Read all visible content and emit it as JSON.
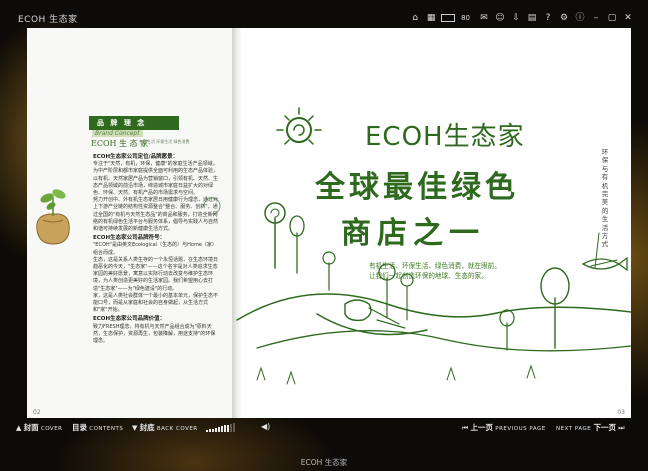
{
  "app": {
    "title": "ECOH 生态家",
    "bottom_title": "ECOH 生态家",
    "zoom_value": "80"
  },
  "toolbar_icons": [
    "home-icon",
    "thumbnails-icon",
    "zoom-out-icon",
    "zoom-in-icon",
    "comment-icon",
    "user-icon",
    "download-icon",
    "print-icon",
    "help-icon",
    "settings-icon",
    "info-icon",
    "minimize-icon",
    "maximize-icon",
    "close-icon"
  ],
  "left_page": {
    "brand_title": "品 牌 理 念",
    "brand_en": "Brand Concept",
    "logo_text": "ECOH 生 态 家",
    "logo_sub": "有机生活 环保生活 绿色消费",
    "page_number": "02",
    "paragraphs": [
      {
        "kind": "heading",
        "text": "ECOH生态家公司定位/品牌愿景："
      },
      {
        "kind": "body",
        "text": "专注于\"天然，有机，环保，健康\"的家庭生活产品领域，为中产阶层和都市家庭提供全面可利用的生态产品体验，以有机、天然家居产品为营销窗口，引领有机、天然、生态产品领域的前沿市场，缔造城市家庭日益扩大的对绿色、环保、天然、有机产品的市场需求与空间。"
      },
      {
        "kind": "body",
        "text": "努力开创中、外有机生态家居日用健康行为理念，通过对上下游产业链的结构性资源整合\"整合、服务、创新\"，通过全国的\"有机与天然生态品\"的商品和服务，打造全新网络的有机绿色生活平台与服务体系，倡导与实践人与自然和谐可持续发展的新健康生活方式。"
      },
      {
        "kind": "heading",
        "text": "ECOH生态家公司品牌符号："
      },
      {
        "kind": "body",
        "text": "\"ECOH\"是由英文Ecological（生态的）与Home（家）组合而成。"
      },
      {
        "kind": "body",
        "text": "生态，这是关系人类生存的一个永恒话题，在生态环境日趋恶化的今天，\"生态家\"——这个名字是对人类追求生态家园的美好愿景，寓意以实际行动去改变与维护生态环境，为人类创造更美好的生活家园。我们希望用心去打造\"生态家\"——为\"绿色建设\"的行动。"
      },
      {
        "kind": "body",
        "text": "家，这是人类社会群体一个最小的基本单元，保护生态不能口号，而是从家庭和社会的自身做起，从生活方式和\"家\"开始。"
      },
      {
        "kind": "heading",
        "text": "ECOH生态家公司品牌价值："
      },
      {
        "kind": "body",
        "text": "致力FRESH理念，将有机与天然产品组合成为\"原料天然，生态保护，资源再生，包装降解，用途支持\"的环保理念。"
      }
    ]
  },
  "right_page": {
    "title_line1": "ECOH生态家",
    "title_line2": "全球最佳绿色",
    "title_line3": "商店之一",
    "subtitle_line1": "有机生活、环保生活、绿色消费，就在眼前。",
    "subtitle_line2": "让我们一起创造环保的地球、生态的家。",
    "vertical_text": "环保与有机完美的生活方式",
    "page_number": "03"
  },
  "footer": {
    "cover_arrow": "▲",
    "cover_label": "封面",
    "cover_en": "COVER",
    "contents_label": "目录",
    "contents_en": "CONTENTS",
    "back_arrow": "▼",
    "back_label": "封底",
    "back_en": "BACK COVER",
    "volume_level": 0.8,
    "prev_arrow": "⏮",
    "prev_label": "上一页",
    "prev_en": "PREVIOUS PAGE",
    "next_en": "NEXT PAGE",
    "next_label": "下一页",
    "next_arrow": "⏭"
  },
  "colors": {
    "brand_green": "#2e6a1e",
    "window_bg": "#0b0b0b",
    "glow_gold": "#c88c28"
  }
}
